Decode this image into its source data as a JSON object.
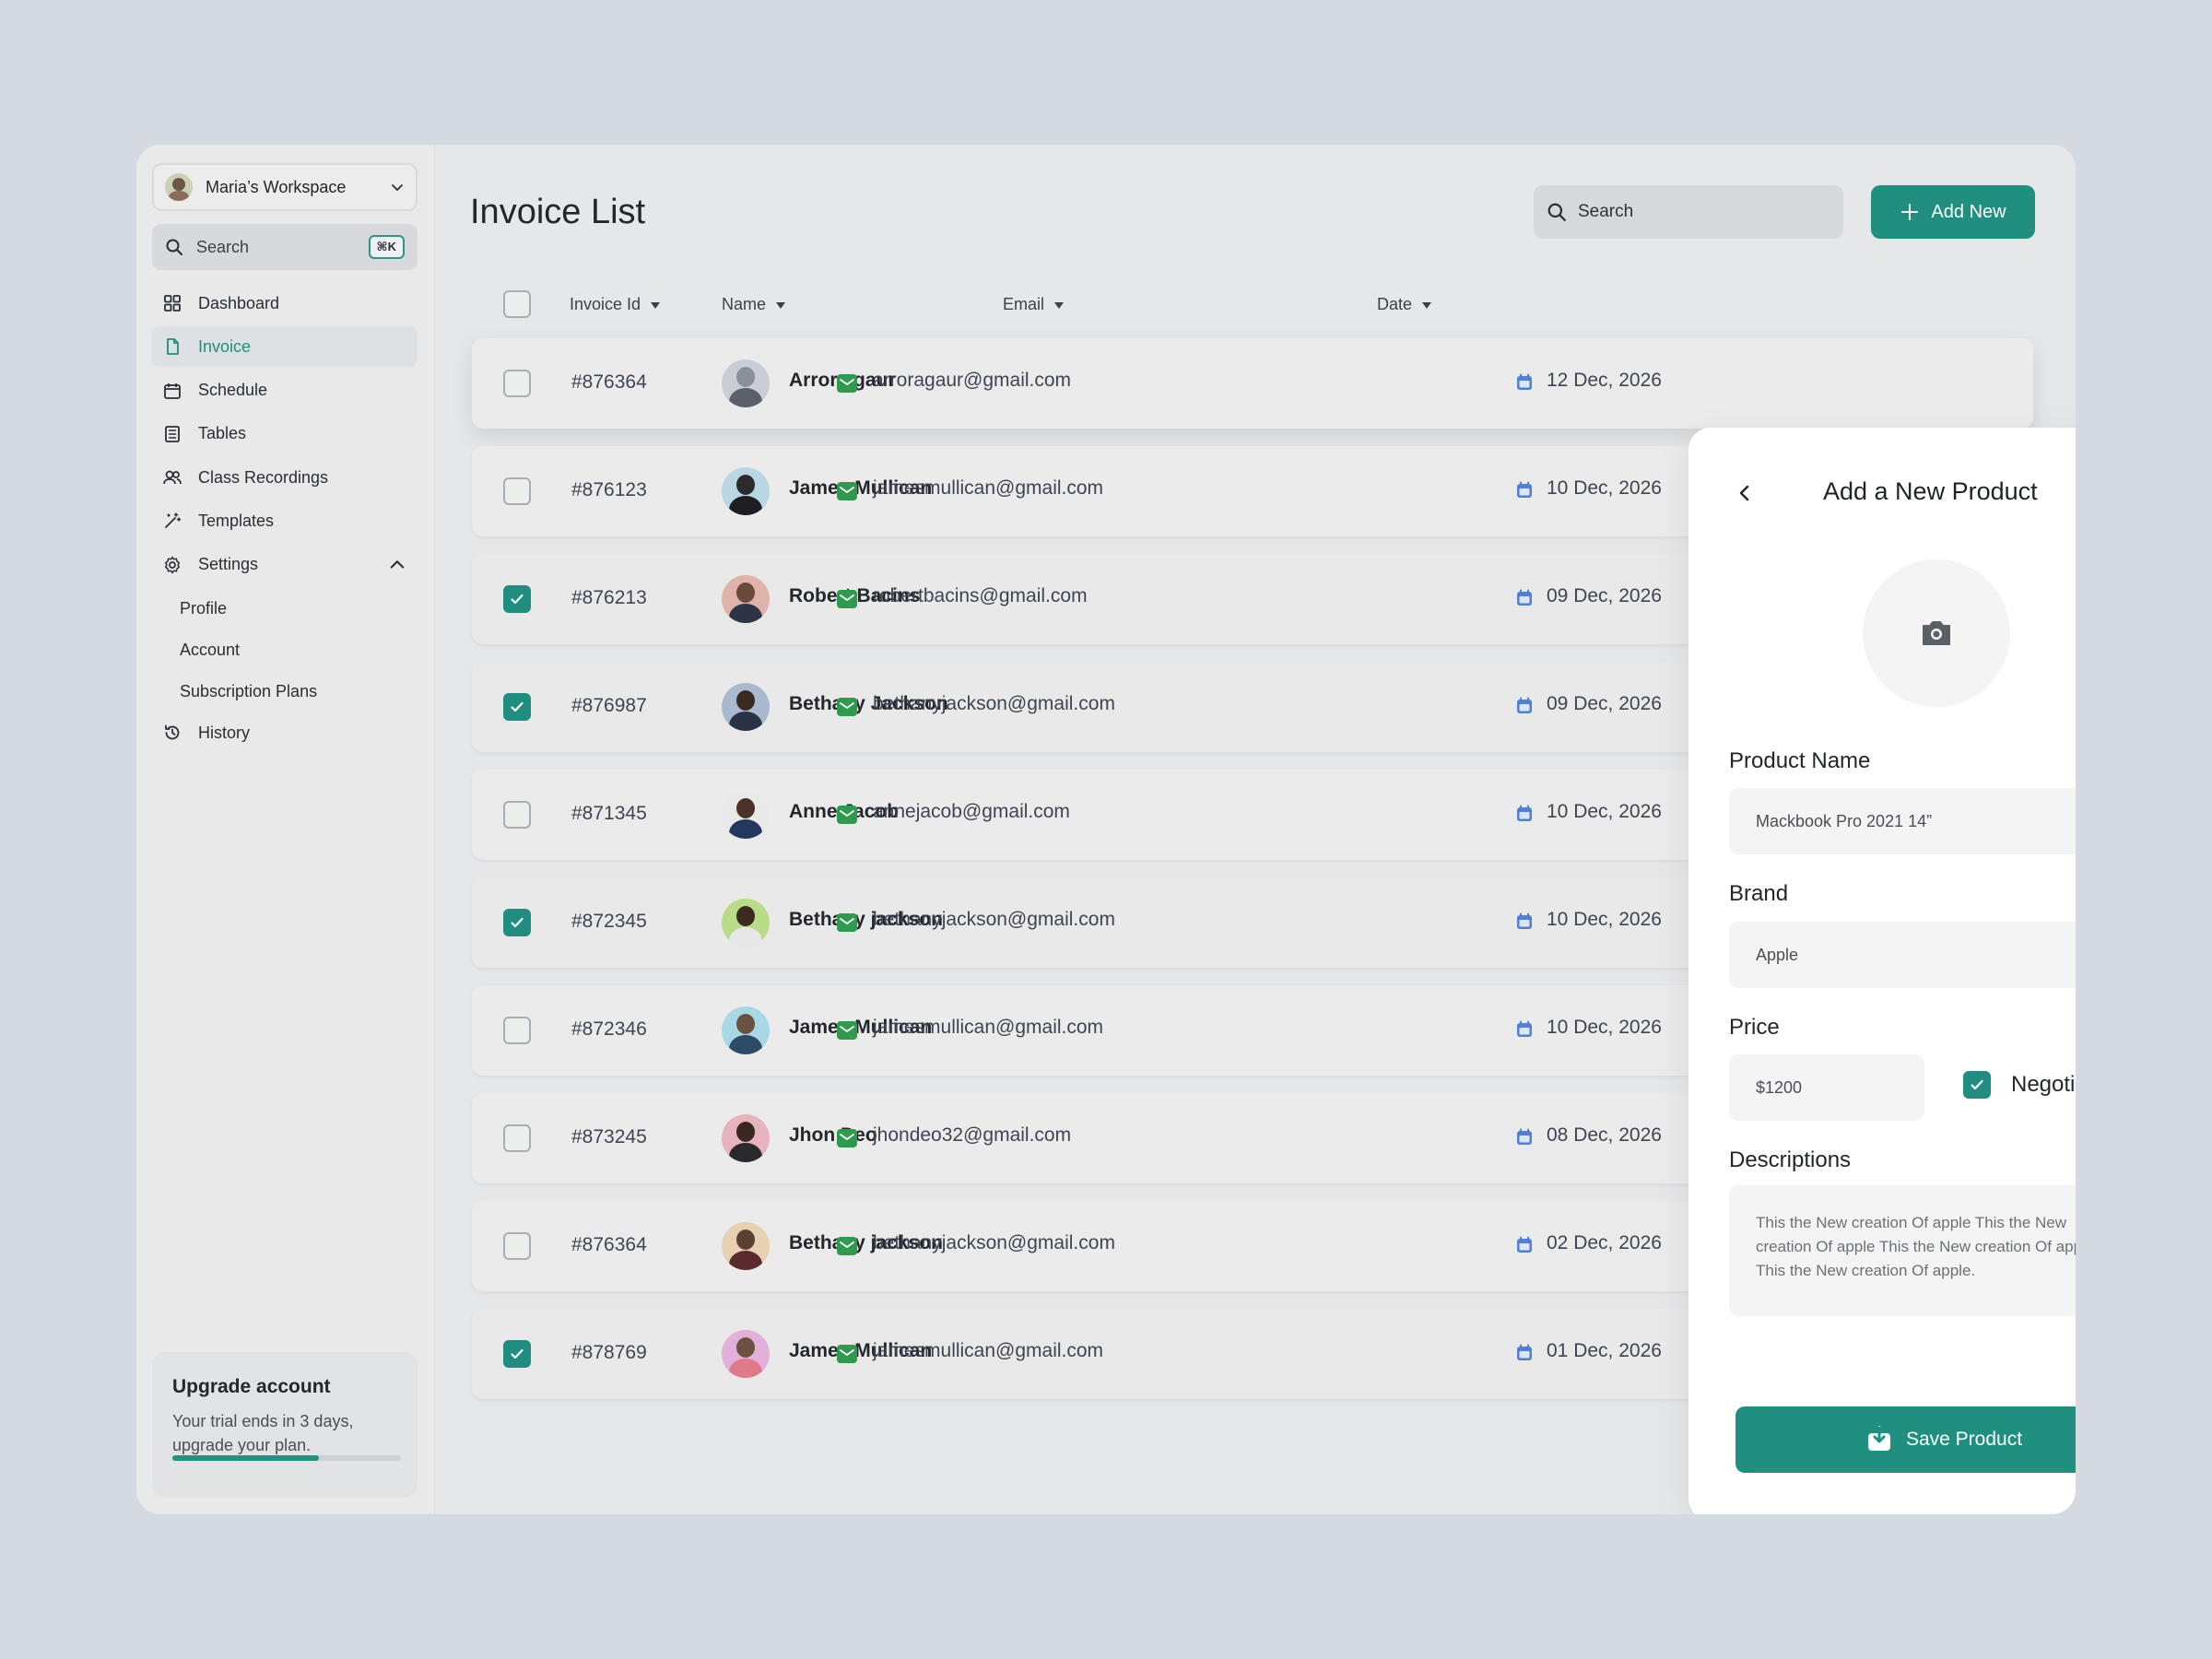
{
  "sidebar": {
    "workspace": "Maria’s Workspace",
    "search": {
      "placeholder": "Search",
      "shortcut": "⌘K"
    },
    "nav": [
      {
        "label": "Dashboard",
        "icon": "grid-icon"
      },
      {
        "label": "Invoice",
        "icon": "document-icon",
        "active": true
      },
      {
        "label": "Schedule",
        "icon": "calendar-icon"
      },
      {
        "label": "Tables",
        "icon": "table-icon"
      },
      {
        "label": "Class Recordings",
        "icon": "users-icon"
      },
      {
        "label": "Templates",
        "icon": "wand-icon"
      },
      {
        "label": "Settings",
        "icon": "gear-icon",
        "expanded": true
      }
    ],
    "settings_sub": [
      "Profile",
      "Account",
      "Subscription Plans"
    ],
    "history": {
      "label": "History",
      "icon": "history-icon"
    },
    "upgrade": {
      "title": "Upgrade account",
      "desc": "Your trial ends in 3 days, upgrade your plan.",
      "progress": 0.64
    }
  },
  "header": {
    "title": "Invoice List",
    "search_placeholder": "Search",
    "add_new": "Add New"
  },
  "table": {
    "columns": [
      "Invoice Id",
      "Name",
      "Email",
      "Date"
    ],
    "rows": [
      {
        "id": "#876364",
        "name": "Arrora gaur",
        "email": "arroragaur@gmail.com",
        "date": "12 Dec, 2026",
        "checked": false
      },
      {
        "id": "#876123",
        "name": "James Mullican",
        "email": "jamesmullican@gmail.com",
        "date": "10 Dec, 2026",
        "checked": false
      },
      {
        "id": "#876213",
        "name": "Robert Bacins",
        "email": "robertbacins@gmail.com",
        "date": "09 Dec, 2026",
        "checked": true
      },
      {
        "id": "#876987",
        "name": "Bethany Jackson",
        "email": "bethanyjackson@gmail.com",
        "date": "09 Dec, 2026",
        "checked": true
      },
      {
        "id": "#871345",
        "name": "Anne Jacob",
        "email": "annejacob@gmail.com",
        "date": "10 Dec, 2026",
        "checked": false
      },
      {
        "id": "#872345",
        "name": "Bethany jackson",
        "email": "bethanyjackson@gmail.com",
        "date": "10 Dec, 2026",
        "checked": true
      },
      {
        "id": "#872346",
        "name": "James Mullican",
        "email": "jamesmullican@gmail.com",
        "date": "10 Dec, 2026",
        "checked": false
      },
      {
        "id": "#873245",
        "name": "Jhon Deo",
        "email": "jhondeo32@gmail.com",
        "date": "08 Dec, 2026",
        "checked": false
      },
      {
        "id": "#876364",
        "name": "Bethany jackson",
        "email": "bethanyjackson@gmail.com",
        "date": "02 Dec, 2026",
        "checked": false
      },
      {
        "id": "#878769",
        "name": "James Mullican",
        "email": "jamesmullican@gmail.com",
        "date": "01 Dec, 2026",
        "checked": true
      }
    ]
  },
  "panel": {
    "title": "Add a New Product",
    "product_name_label": "Product Name",
    "product_name_value": "Mackbook Pro 2021 14”",
    "brand_label": "Brand",
    "brand_value": "Apple",
    "price_label": "Price",
    "price_value": "$1200",
    "negotiable_label": "Negotiable",
    "negotiable_checked": true,
    "descriptions_label": "Descriptions",
    "descriptions_value": "This the New creation Of apple  This the New creation Of apple This the New creation Of apple This the New creation Of apple.",
    "save_label": "Save Product"
  },
  "colors": {
    "accent": "#208f80",
    "background": "#d5d9e0",
    "mail_icon": "#2f9a4d",
    "calendar_icon": "#4f7fd6"
  }
}
